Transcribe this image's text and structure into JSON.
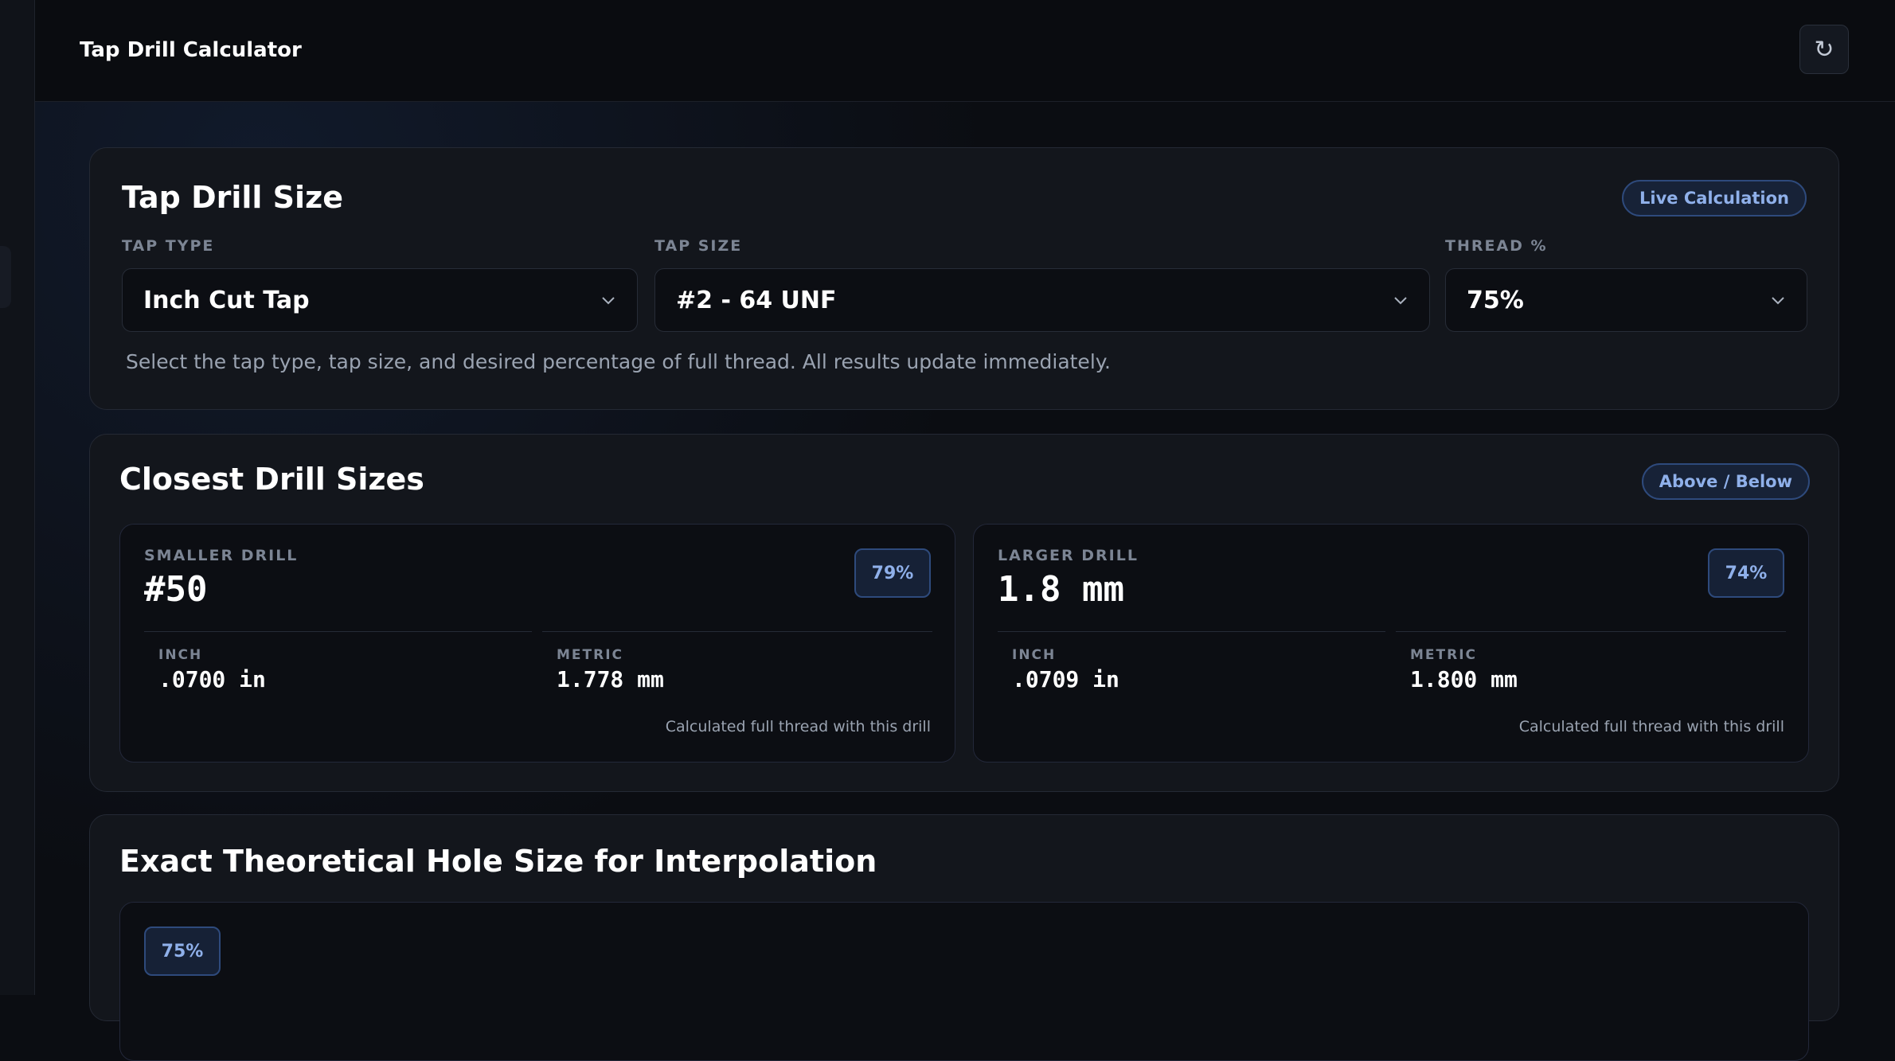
{
  "app": {
    "title": "Tap Drill Calculator",
    "refresh_icon": "↻"
  },
  "input_card": {
    "title": "Tap Drill Size",
    "badge": "Live Calculation",
    "fields": [
      {
        "label": "TAP TYPE",
        "value": "Inch Cut Tap"
      },
      {
        "label": "TAP SIZE",
        "value": "#2 - 64 UNF"
      },
      {
        "label": "THREAD %",
        "value": "75%"
      }
    ],
    "help": "Select the tap type, tap size, and desired percentage of full thread. All results update immediately."
  },
  "closest_card": {
    "title": "Closest Drill Sizes",
    "badge": "Above / Below",
    "drills": [
      {
        "kicker": "SMALLER DRILL",
        "size": "#50",
        "percent": "79%",
        "inch_label": "INCH",
        "inch_value": ".0700 in",
        "metric_label": "METRIC",
        "metric_value": "1.778 mm",
        "note": "Calculated full thread with this drill"
      },
      {
        "kicker": "LARGER DRILL",
        "size": "1.8 mm",
        "percent": "74%",
        "inch_label": "INCH",
        "inch_value": ".0709 in",
        "metric_label": "METRIC",
        "metric_value": "1.800 mm",
        "note": "Calculated full thread with this drill"
      }
    ]
  },
  "interp_card": {
    "title": "Exact Theoretical Hole Size for Interpolation",
    "percent": "75%"
  },
  "colors": {
    "accent": "#8fb0ea",
    "background": "#0b0d12",
    "card": "#13161c"
  }
}
